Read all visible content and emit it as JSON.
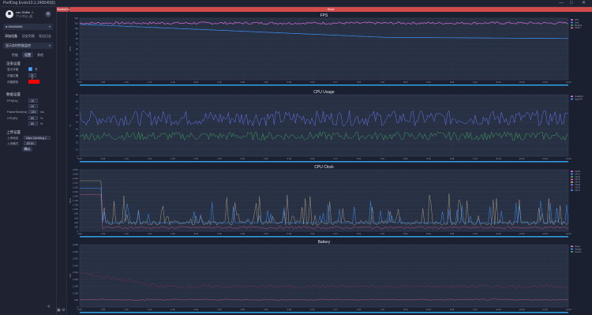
{
  "window": {
    "title": "PerfDog Evolv10.1.240540(6)",
    "controls": [
      "—",
      "□",
      "✕"
    ]
  },
  "user": {
    "name": "van Shillin ☆",
    "sub": "个人中心  退"
  },
  "device": {
    "label": "● MAA5A66"
  },
  "nav_tabs": [
    "添加设备",
    "历史列表",
    "导出日志"
  ],
  "app": {
    "label": "显示实时性能监控"
  },
  "settings_tabs": [
    "性能",
    "设置",
    "其他"
  ],
  "settings": {
    "display_title": "渲染设置",
    "display_rows": [
      {
        "label": "显示浮窗",
        "value": "关"
      },
      {
        "label": "浮窗位置",
        "value": "左上"
      },
      {
        "label": "浮窗颜色",
        "value": ""
      }
    ],
    "data_title": "数据设置",
    "data_rows": [
      {
        "label": "FPS(Hz)",
        "value": "10"
      },
      {
        "label": "",
        "value": "25"
      },
      {
        "label": "FrameTime(ms)",
        "value": "100",
        "unit": "ms"
      },
      {
        "label": "CPU(%)",
        "value": "80",
        "unit": "%"
      },
      {
        "label": "",
        "value": "80",
        "unit": "%"
      }
    ],
    "upload_title": "上传设置",
    "upload_rows": [
      {
        "label": "上传地址",
        "value": "https://perfdog.c"
      },
      {
        "label": "上传格式",
        "value": "JSON"
      }
    ],
    "confirm_label": "确认"
  },
  "toolbar": {
    "screenshot_label": "ScreenCut",
    "start_label": "Start"
  },
  "colors": {
    "fps": "#d46bd6",
    "fps_avg": "#3a8ef0",
    "cpu_total": "#6a76f0",
    "cpu_app": "#3fa35d",
    "clock_a": "#c9b48b",
    "clock_b": "#3a8ef0",
    "clock_c": "#e95a9a",
    "battery": "#7a2e52",
    "battery_b": "#3a8ef0"
  },
  "time_ticks": [
    "0:00",
    "0:35",
    "1:10",
    "1:44",
    "2:18",
    "2:52",
    "3:26",
    "4:00",
    "4:35",
    "5:09",
    "5:43",
    "6:17",
    "6:51",
    "7:25",
    "8:00",
    "8:34",
    "9:08",
    "9:42",
    "10:16",
    "10:50",
    "11:25",
    "12:00"
  ],
  "charts": [
    {
      "title": "FPS",
      "y_label": "FPS",
      "y_ticks": [
        "0",
        "10",
        "20",
        "30",
        "40",
        "50",
        "60",
        "70",
        "80",
        "90",
        "100",
        "110",
        "120"
      ],
      "legend": [
        "FPS",
        "Jank",
        "BigJank",
        "Stutter"
      ]
    },
    {
      "title": "CPU Usage",
      "y_label": "%",
      "y_ticks": [
        "0",
        "10",
        "20",
        "30",
        "40",
        "50",
        "60",
        "70",
        "80",
        "90"
      ],
      "legend": [
        "TotalCPU",
        "AppCPU"
      ]
    },
    {
      "title": "CPU Clock",
      "y_label": "MHz",
      "y_ticks": [
        "0",
        "200",
        "400",
        "600",
        "800",
        "1,000",
        "1,200",
        "1,400",
        "1,600",
        "1,800",
        "2,000",
        "2,200",
        "2,400",
        "2,600",
        "2,800"
      ],
      "legend": [
        "CPU0",
        "CPU1",
        "CPU2",
        "CPU3",
        "CPU4",
        "CPU5",
        "CPU6",
        "CPU7"
      ]
    },
    {
      "title": "Battery",
      "y_label": "mW",
      "y_ticks": [
        "0",
        "500",
        "1,000",
        "1,500",
        "2,000",
        "2,500",
        "3,000",
        "3,500",
        "4,000",
        "4,500"
      ],
      "legend": [
        "Power",
        "Voltage",
        "Current"
      ]
    }
  ]
}
